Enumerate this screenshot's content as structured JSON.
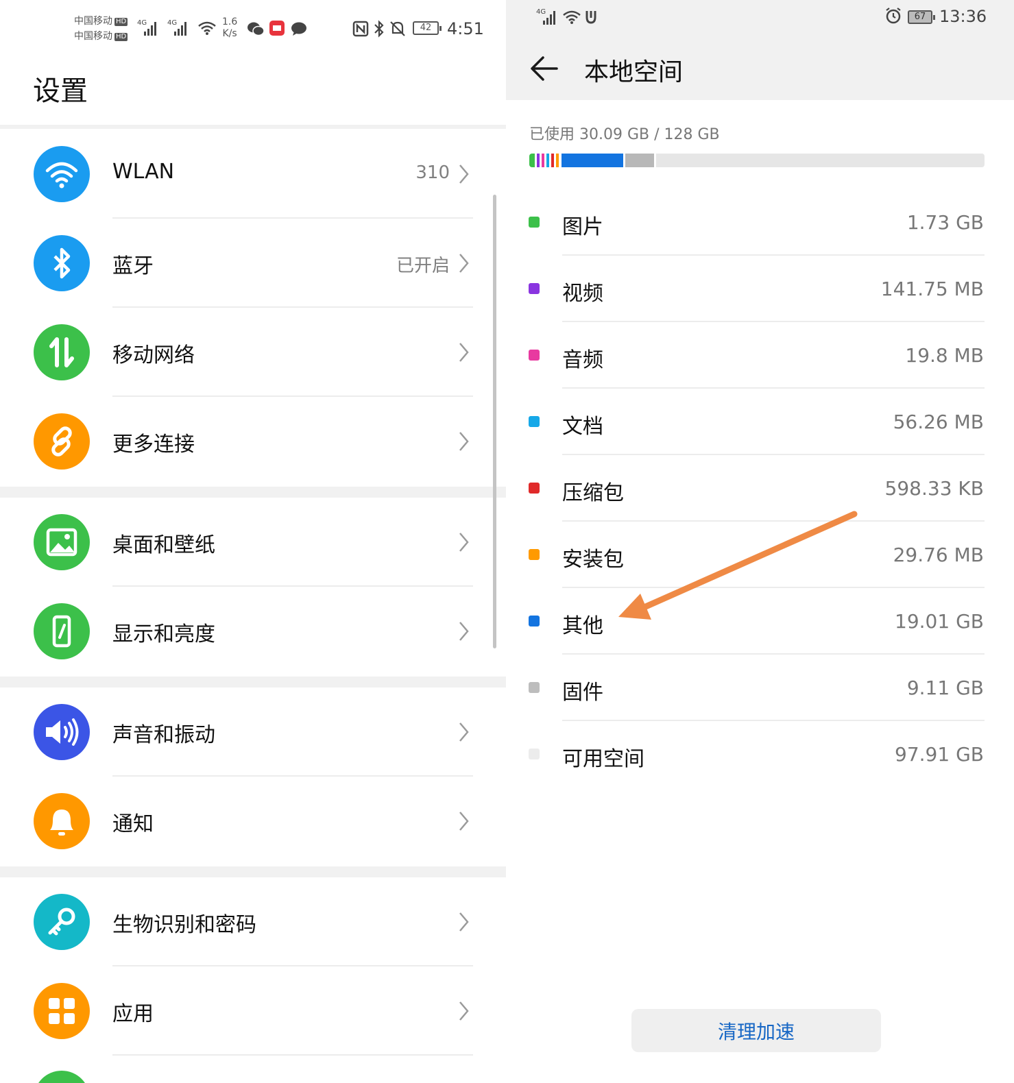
{
  "left": {
    "status_bar": {
      "carrier_1": "中国移动",
      "carrier_2": "中国移动",
      "hd": "HD",
      "net": "4G",
      "speed_value": "1.6",
      "speed_unit": "K/s",
      "battery": "42",
      "time": "4:51",
      "icons": [
        "wechat-icon",
        "app-icon",
        "message-icon",
        "nfc-icon",
        "bluetooth-icon",
        "mute-icon"
      ]
    },
    "title": "设置",
    "items": [
      {
        "label": "WLAN",
        "value": "310",
        "icon": "wifi-icon",
        "color": "#1a9cf0"
      },
      {
        "label": "蓝牙",
        "value": "已开启",
        "icon": "bluetooth-icon",
        "color": "#1a9cf0"
      },
      {
        "label": "移动网络",
        "value": "",
        "icon": "mobile-data-icon",
        "color": "#3cc04a"
      },
      {
        "label": "更多连接",
        "value": "",
        "icon": "link-icon",
        "color": "#ff9800"
      },
      {
        "label": "桌面和壁纸",
        "value": "",
        "icon": "wallpaper-icon",
        "color": "#3cc04a"
      },
      {
        "label": "显示和亮度",
        "value": "",
        "icon": "display-icon",
        "color": "#3cc04a"
      },
      {
        "label": "声音和振动",
        "value": "",
        "icon": "sound-icon",
        "color": "#3b55e6"
      },
      {
        "label": "通知",
        "value": "",
        "icon": "bell-icon",
        "color": "#ff9800"
      },
      {
        "label": "生物识别和密码",
        "value": "",
        "icon": "key-icon",
        "color": "#14b8c8"
      },
      {
        "label": "应用",
        "value": "",
        "icon": "apps-icon",
        "color": "#ff9800"
      }
    ]
  },
  "right": {
    "status_bar": {
      "net": "4G",
      "battery": "67",
      "time": "13:36",
      "icons": [
        "signal-icon",
        "wifi-icon",
        "usb-icon",
        "alarm-icon"
      ]
    },
    "title": "本地空间",
    "used_text": "已使用 30.09 GB / 128 GB",
    "used_fraction": 0.235,
    "categories": [
      {
        "name": "图片",
        "size": "1.73 GB",
        "color": "#3cc04a"
      },
      {
        "name": "视频",
        "size": "141.75 MB",
        "color": "#8a35e0"
      },
      {
        "name": "音频",
        "size": "19.8 MB",
        "color": "#e83aa0"
      },
      {
        "name": "文档",
        "size": "56.26 MB",
        "color": "#16a8e8"
      },
      {
        "name": "压缩包",
        "size": "598.33 KB",
        "color": "#e02a2a"
      },
      {
        "name": "安装包",
        "size": "29.76 MB",
        "color": "#ff9a00"
      },
      {
        "name": "其他",
        "size": "19.01 GB",
        "color": "#1374e0"
      },
      {
        "name": "固件",
        "size": "9.11 GB",
        "color": "#bdbdbd"
      },
      {
        "name": "可用空间",
        "size": "97.91 GB",
        "color": "#ececec"
      }
    ],
    "clean_button": "清理加速",
    "annotation_color": "#ef8a45"
  }
}
